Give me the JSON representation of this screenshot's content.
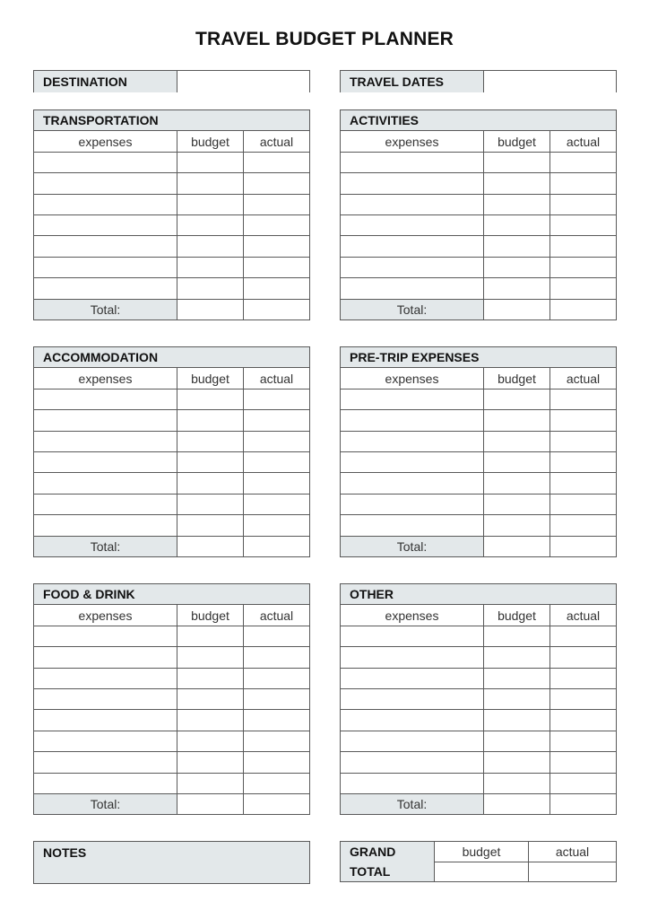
{
  "title": "TRAVEL BUDGET PLANNER",
  "header_fields": {
    "destination": {
      "label": "DESTINATION",
      "value": ""
    },
    "travel_dates": {
      "label": "TRAVEL DATES",
      "value": ""
    }
  },
  "columns": {
    "expenses": "expenses",
    "budget": "budget",
    "actual": "actual"
  },
  "total_label": "Total:",
  "sections": {
    "transportation": {
      "title": "TRANSPORTATION",
      "rows": 7
    },
    "activities": {
      "title": "ACTIVITIES",
      "rows": 7
    },
    "accommodation": {
      "title": "ACCOMMODATION",
      "rows": 7
    },
    "pre_trip": {
      "title": "PRE-TRIP EXPENSES",
      "rows": 7
    },
    "food_drink": {
      "title": "FOOD & DRINK",
      "rows": 8
    },
    "other": {
      "title": "OTHER",
      "rows": 8
    }
  },
  "notes": {
    "label": "NOTES",
    "value": ""
  },
  "grand_total": {
    "label_line1": "GRAND",
    "label_line2": "TOTAL",
    "budget": "budget",
    "actual": "actual",
    "budget_value": "",
    "actual_value": ""
  }
}
